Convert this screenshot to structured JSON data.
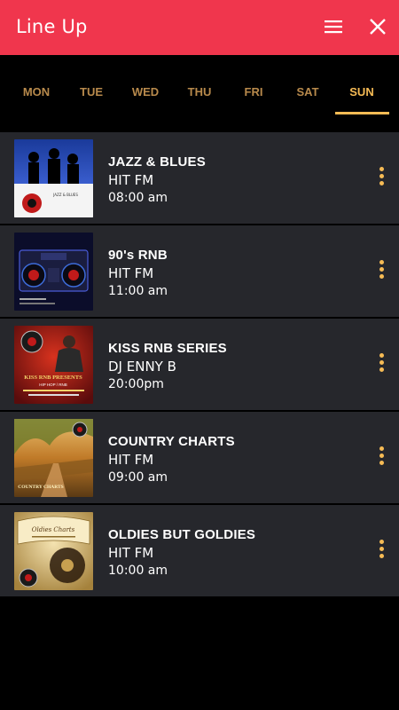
{
  "appbar": {
    "title": "Line Up",
    "menu_icon": "hamburger-menu-icon",
    "close_icon": "close-icon",
    "color": "#f0364d"
  },
  "days": {
    "items": [
      "MON",
      "TUE",
      "WED",
      "THU",
      "FRI",
      "SAT",
      "SUN"
    ],
    "selected": "SUN",
    "accent": "#f6bb55"
  },
  "shows": [
    {
      "title": "JAZZ & BLUES",
      "host": "HIT FM",
      "time": "08:00 am"
    },
    {
      "title": "90's RNB",
      "host": "HIT FM",
      "time": "11:00 am"
    },
    {
      "title": "KISS RNB SERIES",
      "host": "DJ ENNY B",
      "time": "20:00pm"
    },
    {
      "title": "COUNTRY CHARTS",
      "host": "HIT FM",
      "time": "09:00 am"
    },
    {
      "title": "OLDIES BUT GOLDIES",
      "host": "HIT FM",
      "time": "10:00 am"
    }
  ],
  "thumbnails": {
    "jazz": [
      "JAZZ & BLUES"
    ],
    "country": [
      "COUNTRY CHARTS"
    ],
    "kiss": [
      "KISS RNB PRESENTS",
      "HIP HOP / RNB"
    ],
    "oldies": [
      "Oldies Charts"
    ]
  }
}
